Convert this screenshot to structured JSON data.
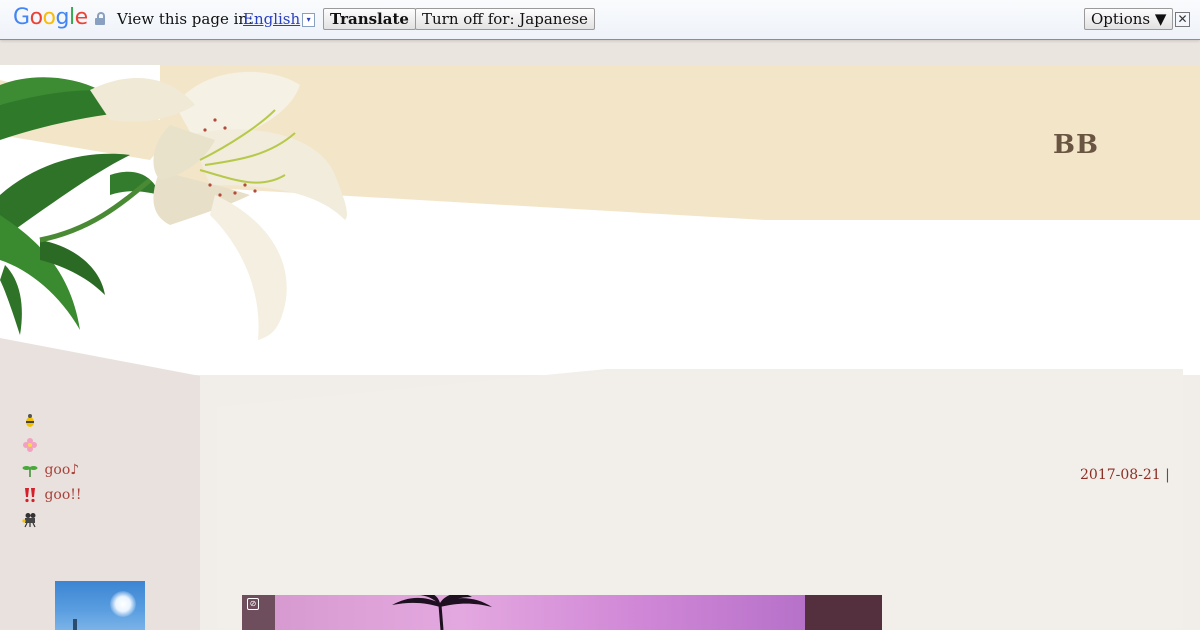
{
  "translate_bar": {
    "logo_text": "Google",
    "view_label": "View this page in:",
    "language": "English",
    "language_dropdown_glyph": "▾",
    "translate_button": "Translate",
    "turn_off_button": "Turn off for: Japanese",
    "options_button": "Options ▼",
    "close_glyph": "✕",
    "logo_colors": [
      "#4285f4",
      "#ea4335",
      "#fbbc05",
      "#4285f4",
      "#34a853",
      "#ea4335"
    ]
  },
  "blog": {
    "title": "BB",
    "header_image": "lily-flower"
  },
  "sidebar": {
    "menu": [
      {
        "icon": "bee-icon",
        "label": ""
      },
      {
        "icon": "flower-icon",
        "label": ""
      },
      {
        "icon": "sprout-icon",
        "label": "goo♪"
      },
      {
        "icon": "double-exclamation-icon",
        "label": "goo!!"
      },
      {
        "icon": "movie-camera-icon",
        "label": ""
      }
    ],
    "thumbnail": "sky-sun-photo"
  },
  "post": {
    "date": "2017-08-21",
    "separator": "|",
    "image": "palm-sunset-photo"
  },
  "colors": {
    "header_beige": "#f3e5c8",
    "sidebar_bg": "#e9e1dd",
    "content_bg": "#f2eee9",
    "link_red": "#a8433b",
    "title_brown": "#6a5442"
  }
}
